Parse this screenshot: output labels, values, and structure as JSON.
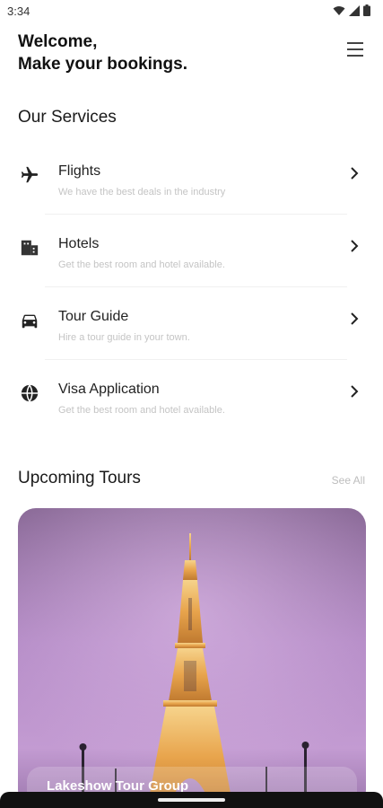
{
  "status": {
    "time": "3:34"
  },
  "header": {
    "line1": "Welcome,",
    "line2": "Make your bookings."
  },
  "services": {
    "title": "Our Services",
    "items": [
      {
        "icon": "airplane-icon",
        "title": "Flights",
        "desc": "We have the best deals in the industry"
      },
      {
        "icon": "hotel-icon",
        "title": "Hotels",
        "desc": "Get the best room and hotel available."
      },
      {
        "icon": "car-icon",
        "title": "Tour Guide",
        "desc": "Hire a tour guide in your town."
      },
      {
        "icon": "globe-icon",
        "title": "Visa Application",
        "desc": "Get the best room and hotel available."
      }
    ]
  },
  "tours": {
    "title": "Upcoming Tours",
    "see_all": "See All",
    "cards": [
      {
        "name": "Lakeshow Tour Group"
      }
    ]
  },
  "colors": {
    "sky_top": "#8d6a9b",
    "sky_mid": "#c08fd0",
    "tower": "#f0b45a"
  }
}
